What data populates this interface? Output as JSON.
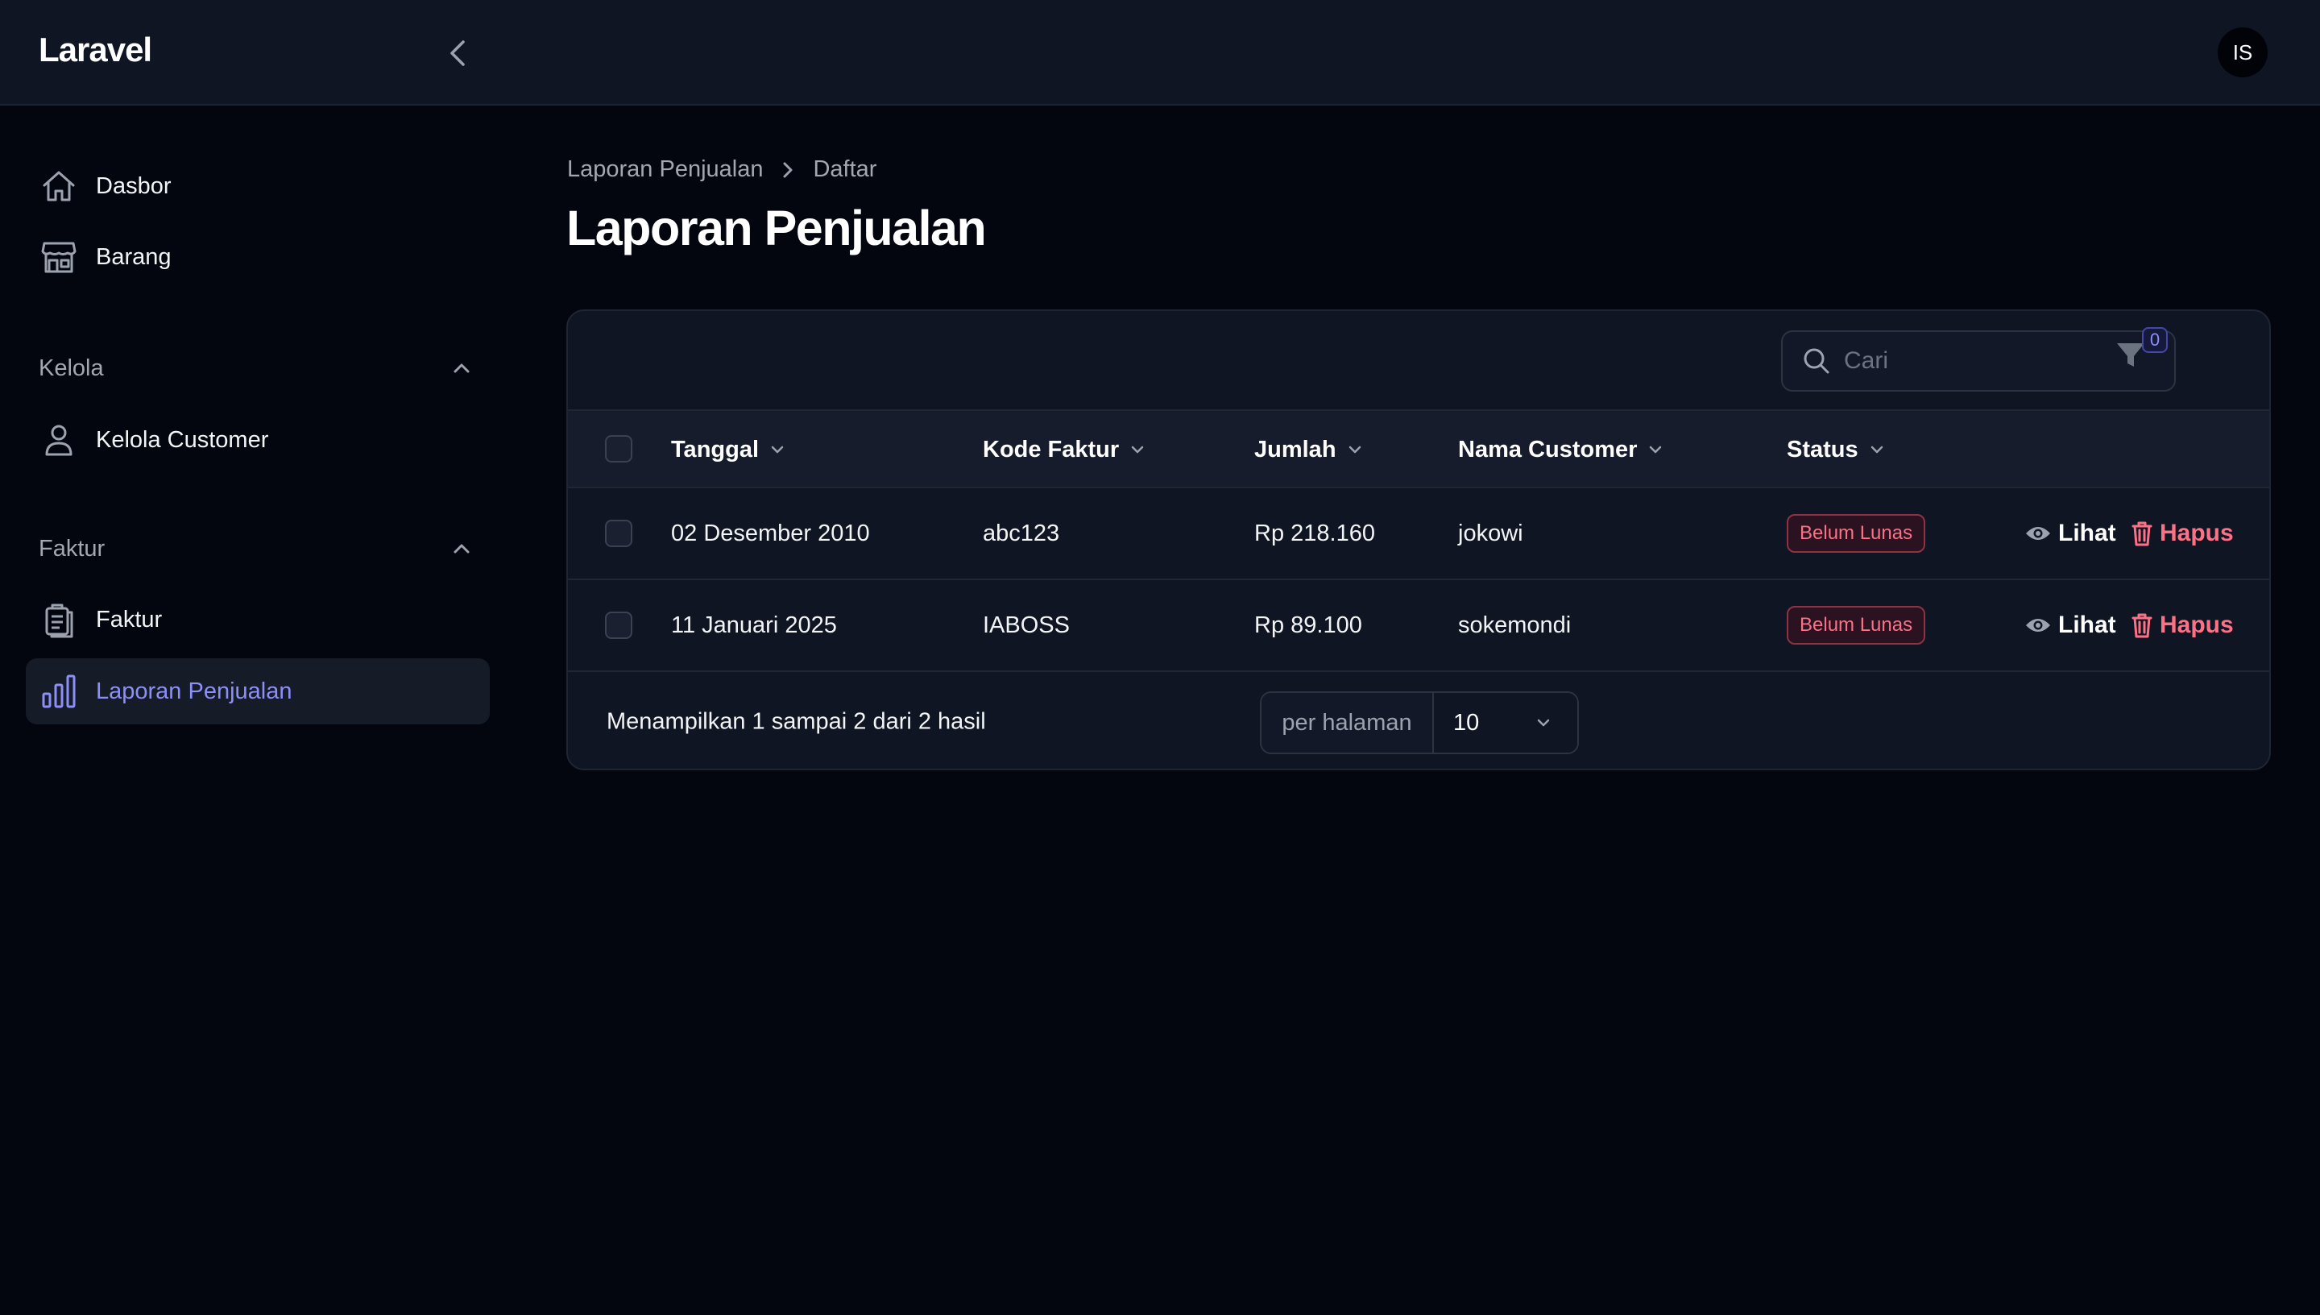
{
  "app": {
    "brand": "Laravel",
    "user_initials": "IS"
  },
  "sidebar": {
    "items": [
      {
        "label": "Dasbor",
        "icon": "home-icon"
      },
      {
        "label": "Barang",
        "icon": "store-icon"
      }
    ],
    "groups": [
      {
        "label": "Kelola",
        "items": [
          {
            "label": "Kelola Customer",
            "icon": "user-icon"
          }
        ]
      },
      {
        "label": "Faktur",
        "items": [
          {
            "label": "Faktur",
            "icon": "clipboard-icon"
          },
          {
            "label": "Laporan Penjualan",
            "icon": "chart-bar-icon",
            "active": true
          }
        ]
      }
    ]
  },
  "breadcrumb": {
    "parent": "Laporan Penjualan",
    "current": "Daftar"
  },
  "page": {
    "title": "Laporan Penjualan"
  },
  "table": {
    "search_placeholder": "Cari",
    "filter_count": "0",
    "columns": [
      "Tanggal",
      "Kode Faktur",
      "Jumlah",
      "Nama Customer",
      "Status"
    ],
    "rows": [
      {
        "tanggal": "02 Desember 2010",
        "kode": "abc123",
        "jumlah": "Rp 218.160",
        "customer": "jokowi",
        "status": "Belum Lunas"
      },
      {
        "tanggal": "11 Januari 2025",
        "kode": "IABOSS",
        "jumlah": "Rp 89.100",
        "customer": "sokemondi",
        "status": "Belum Lunas"
      }
    ],
    "actions": {
      "view": "Lihat",
      "delete": "Hapus"
    },
    "summary": "Menampilkan 1 sampai 2 dari 2 hasil",
    "per_page_label": "per halaman",
    "per_page_value": "10"
  },
  "colors": {
    "accent": "#8d8ff8",
    "danger": "#fb7185",
    "background": "#03060f",
    "surface": "#0f1523"
  }
}
